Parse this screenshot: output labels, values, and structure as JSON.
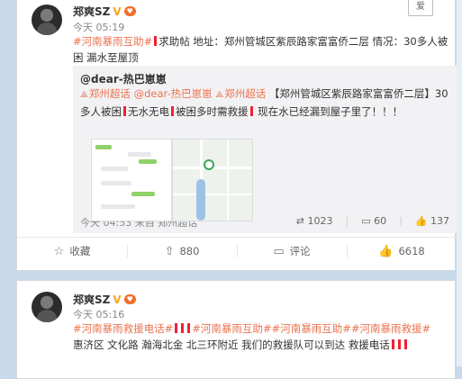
{
  "post1": {
    "author": "郑爽SZ",
    "time": "今天 05:19",
    "follow_label": "爱",
    "text": {
      "tag": "#河南暴雨互助#",
      "help": "求助帖",
      "rest1": " 地址：郑州管城区紫辰路家富富侨二层 情况：30多人被困 漏水至屋顶"
    },
    "repost": {
      "author": "@dear-热巴崽崽",
      "loc1": "郑州超话",
      "mention": "@dear-热巴崽崽",
      "loc2": "郑州超话",
      "body1": " 【郑州管城区紫辰路家富富侨二层】30多人被困",
      "body2": "无水无电",
      "body3": "被困多时需救援",
      "body4": " 现在水已经漏到屋子里了！！！",
      "time": "今天 04:53 来自 郑州超话",
      "reposts": "1023",
      "comments": "60",
      "likes": "137"
    },
    "actions": {
      "collect": "收藏",
      "share": "880",
      "comment": "评论",
      "like": "6618"
    }
  },
  "post2": {
    "author": "郑爽SZ",
    "time": "今天 05:16",
    "tags": "#河南暴雨救援电话#",
    "tag2": "#河南暴雨互助#",
    "tag3": "#河南暴雨互助#",
    "tag4": "#河南暴雨救援#",
    "line2": "惠济区  文化路  瀚海北金  北三环附近 我们的救援队可以到达 救援电话"
  }
}
